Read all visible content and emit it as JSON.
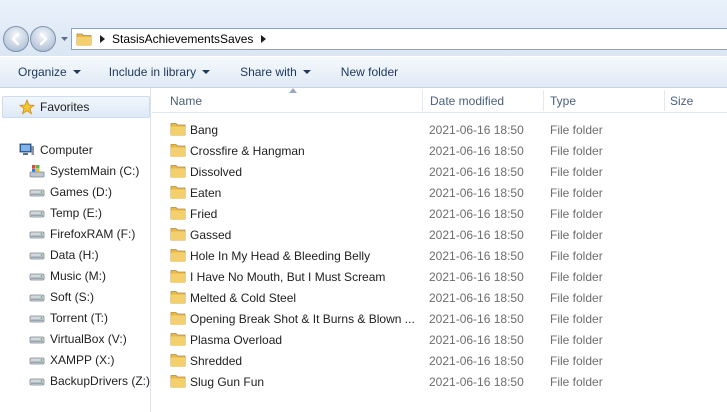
{
  "address": {
    "path": [
      "StasisAchievementsSaves"
    ]
  },
  "toolbar": {
    "organize": "Organize",
    "include_in_library": "Include in library",
    "share_with": "Share with",
    "new_folder": "New folder"
  },
  "sidebar": {
    "favorites": "Favorites",
    "computer": "Computer",
    "drives": [
      {
        "label": "SystemMain (C:)",
        "icon": "system-drive-icon"
      },
      {
        "label": "Games (D:)",
        "icon": "drive-icon"
      },
      {
        "label": "Temp (E:)",
        "icon": "drive-icon"
      },
      {
        "label": "FirefoxRAM (F:)",
        "icon": "drive-icon"
      },
      {
        "label": "Data (H:)",
        "icon": "drive-icon"
      },
      {
        "label": "Music (M:)",
        "icon": "drive-icon"
      },
      {
        "label": "Soft (S:)",
        "icon": "drive-icon"
      },
      {
        "label": "Torrent (T:)",
        "icon": "drive-icon"
      },
      {
        "label": "VirtualBox (V:)",
        "icon": "drive-icon"
      },
      {
        "label": "XAMPP (X:)",
        "icon": "drive-icon"
      },
      {
        "label": "BackupDrivers (Z:)",
        "icon": "drive-icon"
      }
    ]
  },
  "columns": {
    "name": "Name",
    "date_modified": "Date modified",
    "type": "Type",
    "size": "Size"
  },
  "files": [
    {
      "name": "Bang",
      "date": "2021-06-16 18:50",
      "type": "File folder"
    },
    {
      "name": "Crossfire & Hangman",
      "date": "2021-06-16 18:50",
      "type": "File folder"
    },
    {
      "name": "Dissolved",
      "date": "2021-06-16 18:50",
      "type": "File folder"
    },
    {
      "name": "Eaten",
      "date": "2021-06-16 18:50",
      "type": "File folder"
    },
    {
      "name": "Fried",
      "date": "2021-06-16 18:50",
      "type": "File folder"
    },
    {
      "name": "Gassed",
      "date": "2021-06-16 18:50",
      "type": "File folder"
    },
    {
      "name": "Hole In My Head & Bleeding Belly",
      "date": "2021-06-16 18:50",
      "type": "File folder"
    },
    {
      "name": "I Have No Mouth, But I Must Scream",
      "date": "2021-06-16 18:50",
      "type": "File folder"
    },
    {
      "name": "Melted & Cold Steel",
      "date": "2021-06-16 18:50",
      "type": "File folder"
    },
    {
      "name": "Opening Break Shot & It Burns & Blown ...",
      "date": "2021-06-16 18:50",
      "type": "File folder"
    },
    {
      "name": "Plasma Overload",
      "date": "2021-06-16 18:50",
      "type": "File folder"
    },
    {
      "name": "Shredded",
      "date": "2021-06-16 18:50",
      "type": "File folder"
    },
    {
      "name": "Slug Gun Fun",
      "date": "2021-06-16 18:50",
      "type": "File folder"
    }
  ],
  "colors": {
    "folder": "#e8b84a",
    "accent": "#1e395b"
  }
}
